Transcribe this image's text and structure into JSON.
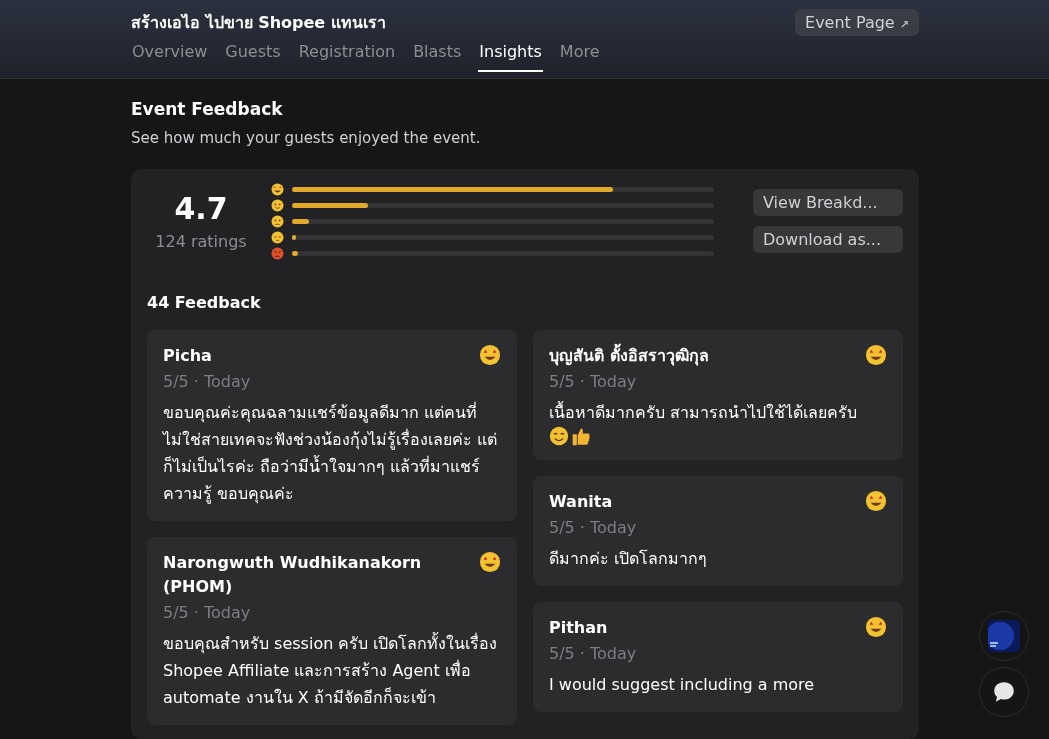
{
  "header": {
    "event_title": "สร้างเอไอ ไปขาย Shopee แทนเรา",
    "event_page_button": "Event Page",
    "arrow": "↗"
  },
  "tabs": [
    {
      "label": "Overview",
      "selected": false
    },
    {
      "label": "Guests",
      "selected": false
    },
    {
      "label": "Registration",
      "selected": false
    },
    {
      "label": "Blasts",
      "selected": false
    },
    {
      "label": "Insights",
      "selected": true
    },
    {
      "label": "More",
      "selected": false
    }
  ],
  "section": {
    "title": "Event Feedback",
    "subtitle": "See how much your guests enjoyed the event."
  },
  "summary": {
    "score": "4.7",
    "ratings": "124 ratings",
    "bars": [
      {
        "kind": "star-struck",
        "level": 0.76
      },
      {
        "kind": "slight-smile",
        "level": 0.18
      },
      {
        "kind": "slight-frown",
        "level": 0.04
      },
      {
        "kind": "disappointed",
        "level": 0.01
      },
      {
        "kind": "angry",
        "level": 0.015
      }
    ],
    "buttons": [
      "View Breakd...",
      "Download as..."
    ]
  },
  "feedback": {
    "title": "44 Feedback",
    "columns": [
      [
        {
          "name": "Picha",
          "meta": "5/5 · Today",
          "kind": "star-struck",
          "text": "ขอบคุณค่ะคุณฉลามแชร์ข้อมูลดีมาก แต่คนที่ไม่ใช่สายเทคจะฟังช่วงน้องกุ้งไม่รู้เรื่องเลยค่ะ แต่ก็ไม่เป็นไรค่ะ ถือว่ามีน้ำใจมากๆ แล้วที่มาแชร์ความรู้ ขอบคุณค่ะ"
        },
        {
          "name": "Narongwuth Wudhikanakorn (PHOM)",
          "meta": "5/5 · Today",
          "kind": "star-struck",
          "text": "ขอบคุณสำหรับ session ครับ เปิดโลกทั้งในเรื่อง Shopee Affiliate และการสร้าง Agent เพื่อ automate งานใน X ถ้ามีจัดอีกก็จะเข้า"
        }
      ],
      [
        {
          "name": "บุญสันติ ตั้งอิสราวุฒิกุล",
          "meta": "5/5 · Today",
          "kind": "star-struck",
          "text": "เนื้อหาดีมากครับ สามารถนำไปใช้ได้เลยครับ",
          "trailing_icons": [
            {
              "kind": "smile"
            },
            {
              "kind": "thumbs-up"
            }
          ]
        },
        {
          "name": "Wanita",
          "meta": "5/5 · Today",
          "kind": "star-struck",
          "text": "ดีมากค่ะ เปิดโลกมากๆ"
        },
        {
          "name": "Pithan",
          "meta": "5/5 · Today",
          "kind": "star-struck",
          "text": "I would suggest including a more"
        }
      ]
    ]
  }
}
